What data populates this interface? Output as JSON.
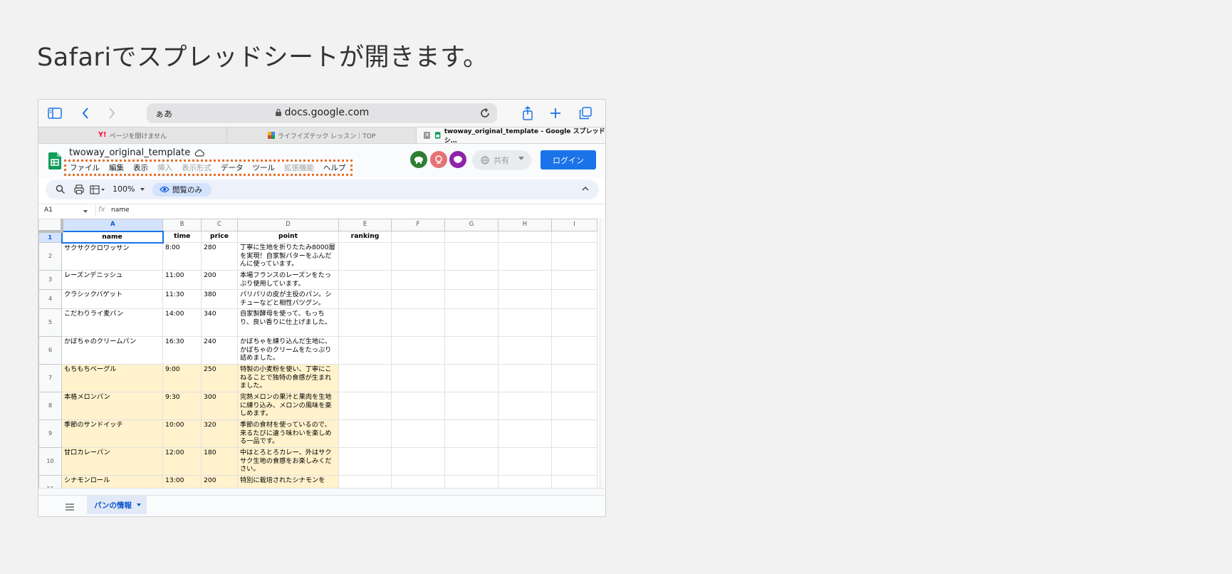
{
  "heading": "Safariでスプレッドシートが開きます。",
  "browser": {
    "url_prefix": "ぁあ",
    "url": "docs.google.com",
    "tabs": [
      {
        "label": "ページを開けません"
      },
      {
        "label": "ライフイズテック レッスン｜TOP"
      },
      {
        "label": "twoway_original_template - Google スプレッドシ…"
      }
    ],
    "close_glyph": "✕"
  },
  "sheets": {
    "title": "twoway_original_template",
    "menu": [
      "ファイル",
      "編集",
      "表示",
      "挿入",
      "表示形式",
      "データ",
      "ツール",
      "拡張機能",
      "ヘルプ"
    ],
    "share_label": "共有",
    "login_label": "ログイン",
    "zoom": "100%",
    "view_only_label": "閲覧のみ",
    "cell_ref": "A1",
    "fx_label": "fx",
    "formula_value": "name",
    "sheet_tab": "パンの情報",
    "accent_color": "#1a73e8",
    "highlight_color": "#fff2cc",
    "highlight_mark_color": "#e8712a"
  },
  "grid": {
    "columns": [
      "A",
      "B",
      "C",
      "D",
      "E",
      "F",
      "G",
      "H",
      "I"
    ],
    "rows": [
      {
        "num": "1",
        "cells": [
          "name",
          "time",
          "price",
          "point",
          "ranking"
        ]
      },
      {
        "num": "2",
        "cells": [
          "サクサククロワッサン",
          "8:00",
          "280",
          "丁寧に生地を折りたたみ8000層を実現！自家製バターをふんだんに使っています。",
          ""
        ]
      },
      {
        "num": "3",
        "cells": [
          "レーズンデニッシュ",
          "11:00",
          "200",
          "本場フランスのレーズンをたっぷり使用しています。",
          ""
        ]
      },
      {
        "num": "4",
        "cells": [
          "クラシックバゲット",
          "11:30",
          "380",
          "パリパリの皮が主役のパン。シチューなどと相性バツグン。",
          ""
        ]
      },
      {
        "num": "5",
        "cells": [
          "こだわりライ麦パン",
          "14:00",
          "340",
          "自家製酵母を使って、もっちり、良い香りに仕上げました。",
          ""
        ]
      },
      {
        "num": "6",
        "cells": [
          "かぼちゃのクリームパン",
          "16:30",
          "240",
          "かぼちゃを練り込んだ生地に、かぼちゃのクリームをたっぷり詰めました。",
          ""
        ]
      },
      {
        "num": "7",
        "cells": [
          "もちもちベーグル",
          "9:00",
          "250",
          "特製の小麦粉を使い、丁寧にこねることで独特の食感が生まれました。",
          ""
        ]
      },
      {
        "num": "8",
        "cells": [
          "本格メロンパン",
          "9:30",
          "300",
          "完熟メロンの果汁と果肉を生地に練り込み、メロンの風味を楽しめます。",
          ""
        ]
      },
      {
        "num": "9",
        "cells": [
          "季節のサンドイッチ",
          "10:00",
          "320",
          "季節の食材を使っているので、来るたびに違う味わいを楽しめる一品です。",
          ""
        ]
      },
      {
        "num": "10",
        "cells": [
          "甘口カレーパン",
          "12:00",
          "180",
          "中はとろとろカレー、外はサクサク生地の食感をお楽しみください。",
          ""
        ]
      },
      {
        "num": "11",
        "cells": [
          "シナモンロール",
          "13:00",
          "200",
          "特別に栽培されたシナモンを",
          ""
        ]
      }
    ]
  }
}
